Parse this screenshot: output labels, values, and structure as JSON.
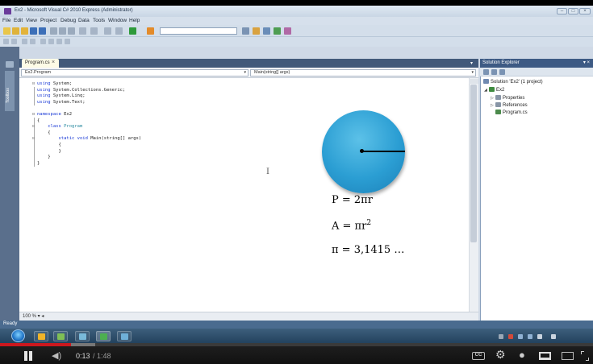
{
  "ide": {
    "window_title": "Ex2 - Microsoft Visual C# 2010 Express (Administrator)",
    "menu": [
      "File",
      "Edit",
      "View",
      "Project",
      "Debug",
      "Data",
      "Tools",
      "Window",
      "Help"
    ],
    "left_tool_tab": "Toolbox",
    "document_tab": "Program.cs",
    "nav_class": "Ex2.Program",
    "nav_member": "Main(string[] args)",
    "zoom": "100 %",
    "status": "Ready",
    "code_lines": [
      {
        "kw": "using",
        "rest": " System;"
      },
      {
        "kw": "using",
        "rest": " System.Collections.Generic;"
      },
      {
        "kw": "using",
        "rest": " System.Linq;"
      },
      {
        "kw": "using",
        "rest": " System.Text;"
      },
      {
        "kw": "",
        "rest": ""
      },
      {
        "kw": "namespace",
        "rest": " Ex2"
      },
      {
        "kw": "",
        "rest": "{"
      },
      {
        "kw": "class",
        "ty": " Program",
        "rest": "",
        "indent": "    "
      },
      {
        "kw": "",
        "rest": "{",
        "indent": "    "
      },
      {
        "kw": "static void",
        "rest": " Main(string[] args)",
        "indent": "        "
      },
      {
        "kw": "",
        "rest": "{",
        "indent": "        "
      },
      {
        "kw": "",
        "rest": "}",
        "indent": "        "
      },
      {
        "kw": "",
        "rest": "}",
        "indent": "    "
      },
      {
        "kw": "",
        "rest": "}"
      }
    ]
  },
  "overlay": {
    "formula_perimeter": "P = 2πr",
    "formula_area_base": "A = πr",
    "formula_area_exp": "2",
    "formula_pi": "π = 3,1415 …"
  },
  "solution_explorer": {
    "title": "Solution Explorer",
    "pin": "▾ ×",
    "solution": "Solution 'Ex2' (1 project)",
    "project": "Ex2",
    "items": [
      "Properties",
      "References",
      "Program.cs"
    ]
  },
  "player": {
    "current_time": "0:13",
    "duration": " / 1:48",
    "progress_fraction": 0.12,
    "buffered_fraction": 0.16,
    "cc_label": "CC"
  },
  "colors": {
    "accent": "#cc181e",
    "circle": "#2b9ed3"
  }
}
